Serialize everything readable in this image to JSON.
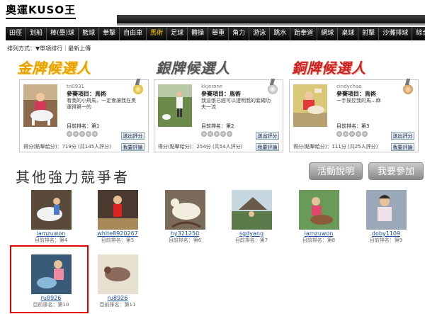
{
  "logo": "奧運KUSO王",
  "nav": [
    "田徑",
    "划船",
    "棒(壘)球",
    "籃球",
    "拳擊",
    "自由車",
    "馬術",
    "足球",
    "體操",
    "舉重",
    "角力",
    "游泳",
    "跳水",
    "跆拳道",
    "網球",
    "桌球",
    "射擊",
    "沙灘排球",
    "綜合"
  ],
  "nav_active": "馬術",
  "sort_label": "排列方式：▼單項排行｜最新上傳",
  "medal_titles": {
    "gold": "金牌候選人",
    "silver": "銀牌候選人",
    "bronze": "銅牌候選人"
  },
  "candidates": {
    "gold": {
      "user": "tn0931",
      "event": "參賽項目：馬術",
      "desc": "看我的小飛馬，一定會讓我在奧運得第一的",
      "rank": "目前排名：第1",
      "score": "得分(點擊給分)：719分 (共145人評分)",
      "rate_btn": "送出評分",
      "comment_btn": "我要評論"
    },
    "silver": {
      "user": "kkjerone",
      "event": "參賽項目：馬術",
      "desc": "我這張已經可以證明我的套繩功夫一流",
      "rank": "目前排名：第2",
      "score": "得分(點擊給分)：254分 (共54人評分)",
      "rate_btn": "送出評分",
      "comment_btn": "我要評論"
    },
    "bronze": {
      "user": "cindychao",
      "event": "參賽項目：馬術",
      "desc": "一手操控我的馬...麻",
      "rank": "目前排名：第3",
      "score": "得分(點擊給分)：111分 (共25人評分)",
      "rate_btn": "送出評分",
      "comment_btn": "我要評論"
    }
  },
  "others_title": "其他強力競爭者",
  "buttons": {
    "info": "活動說明",
    "join": "我要參加"
  },
  "others": [
    {
      "name": "iamzuwon",
      "rank": "目前排名：第4"
    },
    {
      "name": "white8920267",
      "rank": "目前排名：第5"
    },
    {
      "name": "hy321250",
      "rank": "目前排名：第6"
    },
    {
      "name": "sgdyang",
      "rank": "目前排名：第7"
    },
    {
      "name": "iamzuwon",
      "rank": "目前排名：第8"
    },
    {
      "name": "doby1109",
      "rank": "目前排名：第9"
    },
    {
      "name": "ru8926",
      "rank": "目前排名：第10"
    },
    {
      "name": "ru8926",
      "rank": "目前排名：第11"
    }
  ],
  "colors": {
    "gold": "#e8a000",
    "silver": "#555555",
    "bronze": "#cc2222",
    "highlight": "#e00000",
    "link": "#1a4fa0"
  }
}
